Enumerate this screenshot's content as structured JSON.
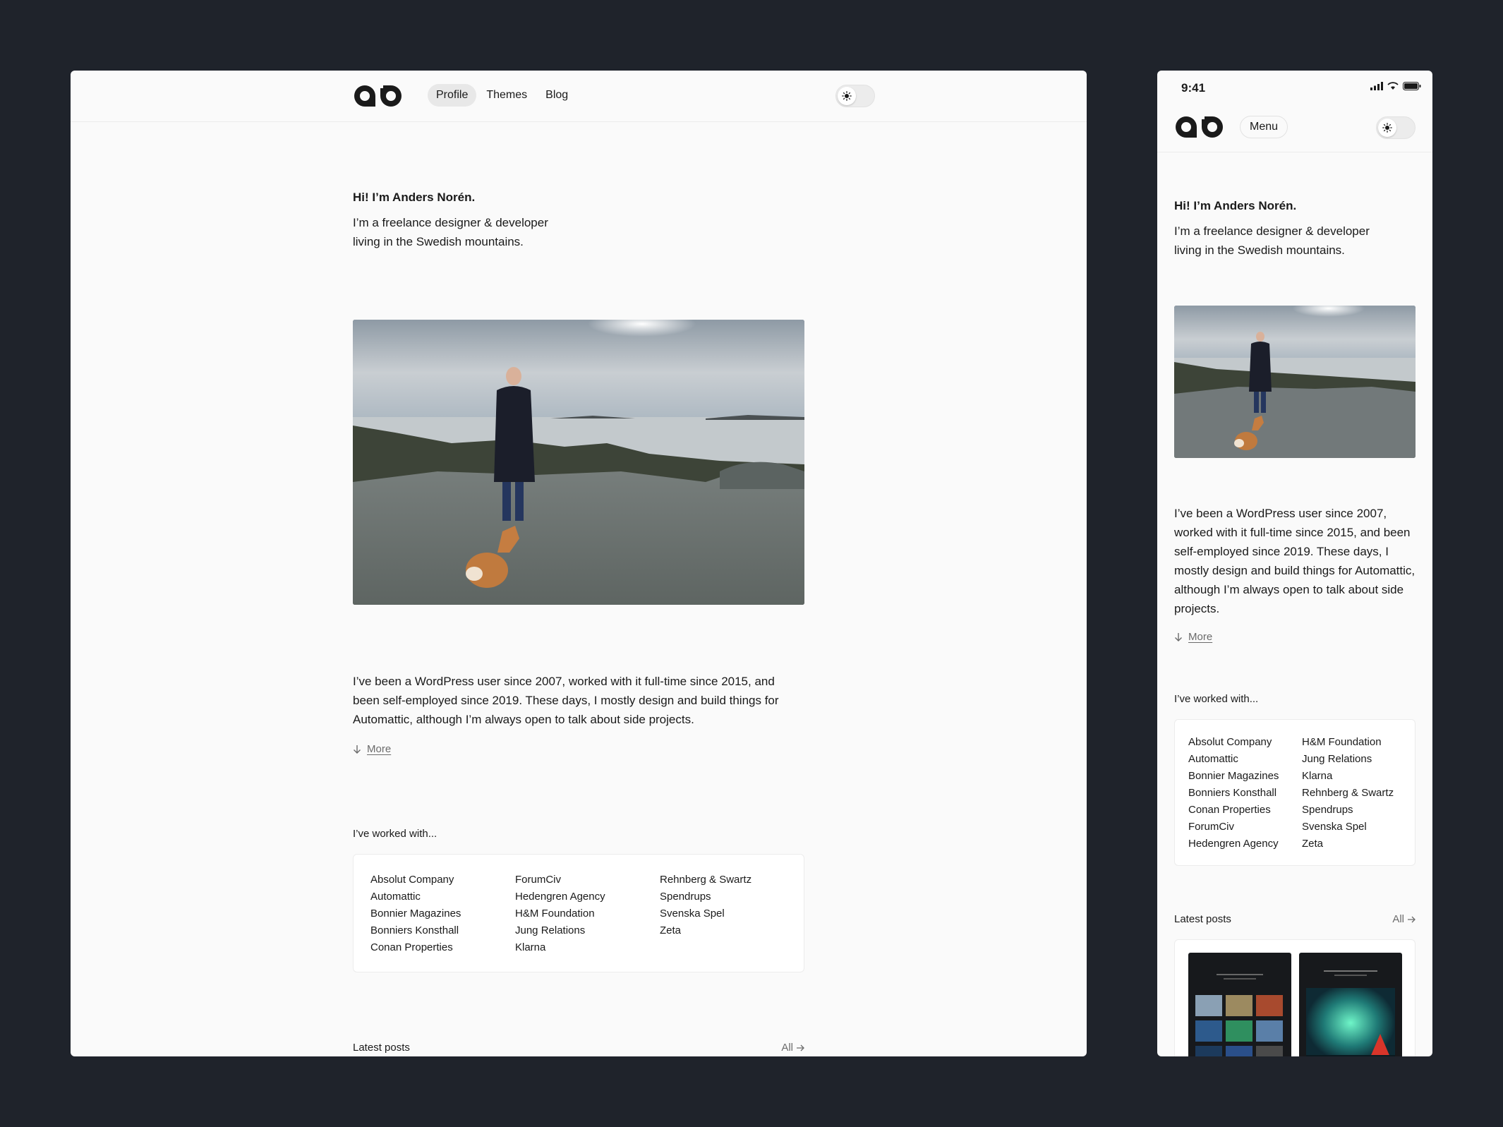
{
  "desktop": {
    "nav": [
      {
        "label": "Profile",
        "active": true
      },
      {
        "label": "Themes",
        "active": false
      },
      {
        "label": "Blog",
        "active": false
      }
    ],
    "theme_toggle_icon": "sun-icon"
  },
  "mobile": {
    "status_time": "9:41",
    "menu_label": "Menu",
    "theme_toggle_icon": "sun-icon"
  },
  "profile": {
    "greeting": "Hi! I’m Anders Norén.",
    "intro_line1": "I’m a freelance designer & developer",
    "intro_line2": "living in the Swedish mountains.",
    "bio": "I’ve been a WordPress user since 2007, worked with it full-time since 2015, and been self-employed since 2019. These days, I mostly design and build things for Automattic, although I’m always open to talk about side projects.",
    "more_label": "More",
    "worked_title": "I’ve worked with...",
    "clients": [
      "Absolut Company",
      "Automattic",
      "Bonnier Magazines",
      "Bonniers Konsthall",
      "Conan Properties",
      "ForumCiv",
      "Hedengren Agency",
      "H&M Foundation",
      "Jung Relations",
      "Klarna",
      "Rehnberg & Swartz",
      "Spendrups",
      "Svenska Spel",
      "Zeta"
    ],
    "latest_title": "Latest posts",
    "all_label": "All"
  },
  "colors": {
    "background": "#1f232b",
    "page": "#fafafa",
    "text": "#1a1a1a",
    "muted": "#6b6b6b"
  }
}
